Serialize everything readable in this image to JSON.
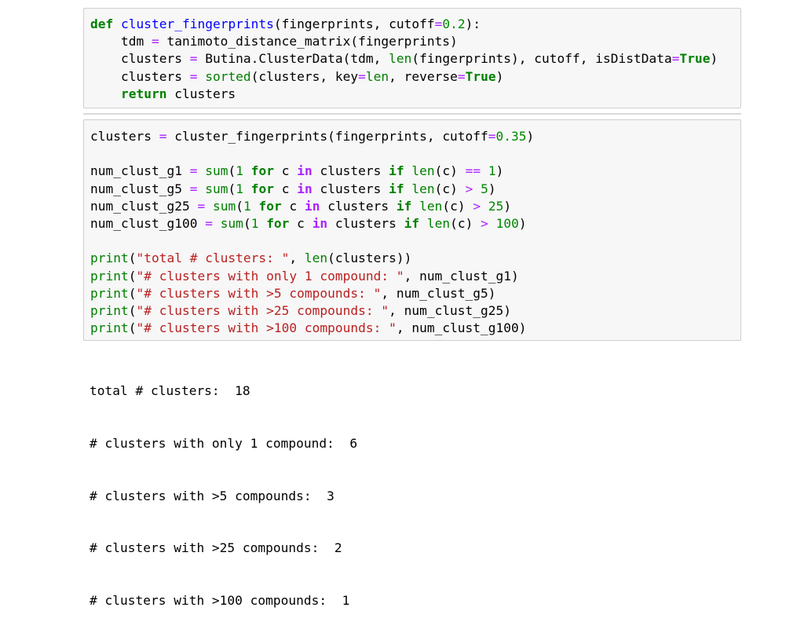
{
  "cells": [
    {
      "lines": [
        [
          [
            "kw",
            "def"
          ],
          [
            "txt",
            " "
          ],
          [
            "fn",
            "cluster_fingerprints"
          ],
          [
            "txt",
            "(fingerprints, cutoff"
          ],
          [
            "op",
            "="
          ],
          [
            "num",
            "0.2"
          ],
          [
            "txt",
            "):"
          ]
        ],
        [
          [
            "txt",
            "    tdm "
          ],
          [
            "op",
            "="
          ],
          [
            "txt",
            " tanimoto_distance_matrix(fingerprints)"
          ]
        ],
        [
          [
            "txt",
            "    clusters "
          ],
          [
            "op",
            "="
          ],
          [
            "txt",
            " Butina.ClusterData(tdm, "
          ],
          [
            "bi",
            "len"
          ],
          [
            "txt",
            "(fingerprints), cutoff, isDistData"
          ],
          [
            "op",
            "="
          ],
          [
            "kw",
            "True"
          ],
          [
            "txt",
            ")"
          ]
        ],
        [
          [
            "txt",
            "    clusters "
          ],
          [
            "op",
            "="
          ],
          [
            "txt",
            " "
          ],
          [
            "bi",
            "sorted"
          ],
          [
            "txt",
            "(clusters, key"
          ],
          [
            "op",
            "="
          ],
          [
            "bi",
            "len"
          ],
          [
            "txt",
            ", reverse"
          ],
          [
            "op",
            "="
          ],
          [
            "kw",
            "True"
          ],
          [
            "txt",
            ")"
          ]
        ],
        [
          [
            "txt",
            "    "
          ],
          [
            "kw",
            "return"
          ],
          [
            "txt",
            " clusters"
          ]
        ]
      ]
    },
    {
      "lines": [
        [
          [
            "txt",
            "clusters "
          ],
          [
            "op",
            "="
          ],
          [
            "txt",
            " cluster_fingerprints(fingerprints, cutoff"
          ],
          [
            "op",
            "="
          ],
          [
            "num",
            "0.35"
          ],
          [
            "txt",
            ")"
          ]
        ],
        [
          [
            "txt",
            ""
          ]
        ],
        [
          [
            "txt",
            "num_clust_g1 "
          ],
          [
            "op",
            "="
          ],
          [
            "txt",
            " "
          ],
          [
            "bi",
            "sum"
          ],
          [
            "txt",
            "("
          ],
          [
            "num",
            "1"
          ],
          [
            "txt",
            " "
          ],
          [
            "kw",
            "for"
          ],
          [
            "txt",
            " c "
          ],
          [
            "opb",
            "in"
          ],
          [
            "txt",
            " clusters "
          ],
          [
            "kw",
            "if"
          ],
          [
            "txt",
            " "
          ],
          [
            "bi",
            "len"
          ],
          [
            "txt",
            "(c) "
          ],
          [
            "op",
            "=="
          ],
          [
            "txt",
            " "
          ],
          [
            "num",
            "1"
          ],
          [
            "txt",
            ")"
          ]
        ],
        [
          [
            "txt",
            "num_clust_g5 "
          ],
          [
            "op",
            "="
          ],
          [
            "txt",
            " "
          ],
          [
            "bi",
            "sum"
          ],
          [
            "txt",
            "("
          ],
          [
            "num",
            "1"
          ],
          [
            "txt",
            " "
          ],
          [
            "kw",
            "for"
          ],
          [
            "txt",
            " c "
          ],
          [
            "opb",
            "in"
          ],
          [
            "txt",
            " clusters "
          ],
          [
            "kw",
            "if"
          ],
          [
            "txt",
            " "
          ],
          [
            "bi",
            "len"
          ],
          [
            "txt",
            "(c) "
          ],
          [
            "op",
            ">"
          ],
          [
            "txt",
            " "
          ],
          [
            "num",
            "5"
          ],
          [
            "txt",
            ")"
          ]
        ],
        [
          [
            "txt",
            "num_clust_g25 "
          ],
          [
            "op",
            "="
          ],
          [
            "txt",
            " "
          ],
          [
            "bi",
            "sum"
          ],
          [
            "txt",
            "("
          ],
          [
            "num",
            "1"
          ],
          [
            "txt",
            " "
          ],
          [
            "kw",
            "for"
          ],
          [
            "txt",
            " c "
          ],
          [
            "opb",
            "in"
          ],
          [
            "txt",
            " clusters "
          ],
          [
            "kw",
            "if"
          ],
          [
            "txt",
            " "
          ],
          [
            "bi",
            "len"
          ],
          [
            "txt",
            "(c) "
          ],
          [
            "op",
            ">"
          ],
          [
            "txt",
            " "
          ],
          [
            "num",
            "25"
          ],
          [
            "txt",
            ")"
          ]
        ],
        [
          [
            "txt",
            "num_clust_g100 "
          ],
          [
            "op",
            "="
          ],
          [
            "txt",
            " "
          ],
          [
            "bi",
            "sum"
          ],
          [
            "txt",
            "("
          ],
          [
            "num",
            "1"
          ],
          [
            "txt",
            " "
          ],
          [
            "kw",
            "for"
          ],
          [
            "txt",
            " c "
          ],
          [
            "opb",
            "in"
          ],
          [
            "txt",
            " clusters "
          ],
          [
            "kw",
            "if"
          ],
          [
            "txt",
            " "
          ],
          [
            "bi",
            "len"
          ],
          [
            "txt",
            "(c) "
          ],
          [
            "op",
            ">"
          ],
          [
            "txt",
            " "
          ],
          [
            "num",
            "100"
          ],
          [
            "txt",
            ")"
          ]
        ],
        [
          [
            "txt",
            ""
          ]
        ],
        [
          [
            "bi",
            "print"
          ],
          [
            "txt",
            "("
          ],
          [
            "str",
            "\"total # clusters: \""
          ],
          [
            "txt",
            ", "
          ],
          [
            "bi",
            "len"
          ],
          [
            "txt",
            "(clusters))"
          ]
        ],
        [
          [
            "bi",
            "print"
          ],
          [
            "txt",
            "("
          ],
          [
            "str",
            "\"# clusters with only 1 compound: \""
          ],
          [
            "txt",
            ", num_clust_g1)"
          ]
        ],
        [
          [
            "bi",
            "print"
          ],
          [
            "txt",
            "("
          ],
          [
            "str",
            "\"# clusters with >5 compounds: \""
          ],
          [
            "txt",
            ", num_clust_g5)"
          ]
        ],
        [
          [
            "bi",
            "print"
          ],
          [
            "txt",
            "("
          ],
          [
            "str",
            "\"# clusters with >25 compounds: \""
          ],
          [
            "txt",
            ", num_clust_g25)"
          ]
        ],
        [
          [
            "bi",
            "print"
          ],
          [
            "txt",
            "("
          ],
          [
            "str",
            "\"# clusters with >100 compounds: \""
          ],
          [
            "txt",
            ", num_clust_g100)"
          ]
        ]
      ]
    }
  ],
  "output": {
    "lines": [
      "total # clusters:  18",
      "# clusters with only 1 compound:  6",
      "# clusters with >5 compounds:  3",
      "# clusters with >25 compounds:  2",
      "# clusters with >100 compounds:  1"
    ]
  }
}
